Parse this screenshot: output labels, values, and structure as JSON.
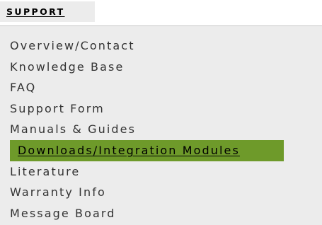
{
  "section": {
    "title": "SUPPORT"
  },
  "colors": {
    "panel_bg": "#ececec",
    "active_bg": "#6e9a2a",
    "text": "#333333"
  },
  "menu": {
    "active_index": 5,
    "items": [
      {
        "label": "Overview/Contact"
      },
      {
        "label": "Knowledge Base"
      },
      {
        "label": "FAQ"
      },
      {
        "label": "Support Form"
      },
      {
        "label": "Manuals & Guides"
      },
      {
        "label": "Downloads/Integration Modules"
      },
      {
        "label": "Literature"
      },
      {
        "label": "Warranty Info"
      },
      {
        "label": "Message Board"
      }
    ]
  }
}
